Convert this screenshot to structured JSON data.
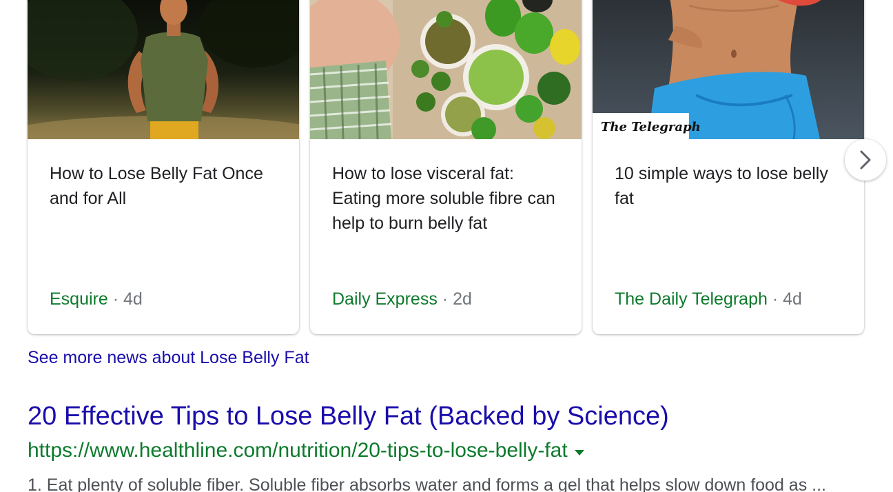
{
  "news_carousel": {
    "cards": [
      {
        "title": "How to Lose Belly Fat Once and for All",
        "source": "Esquire",
        "separator": "·",
        "age": "4d",
        "thumbnail_icon": "runner-photo"
      },
      {
        "title": "How to lose visceral fat: Eating more soluble fibre can help to burn belly fat",
        "source": "Daily Express",
        "separator": "·",
        "age": "2d",
        "thumbnail_icon": "vegetables-belly-photo"
      },
      {
        "title": "10 simple ways to lose belly fat",
        "source": "The Daily Telegraph",
        "separator": "·",
        "age": "4d",
        "thumbnail_icon": "waist-photo",
        "thumbnail_badge": "The Telegraph"
      }
    ],
    "next_icon": "chevron-right-icon"
  },
  "see_more": {
    "label": "See more news about Lose Belly Fat"
  },
  "result": {
    "title": "20 Effective Tips to Lose Belly Fat (Backed by Science)",
    "url": "https://www.healthline.com/nutrition/20-tips-to-lose-belly-fat",
    "snippet": "1. Eat plenty of soluble fiber. Soluble fiber absorbs water and forms a gel that helps slow down food as ..."
  },
  "colors": {
    "link_blue": "#1a0dab",
    "source_green": "#0d7a2c",
    "meta_gray": "#70757a",
    "title_text": "#202124"
  }
}
